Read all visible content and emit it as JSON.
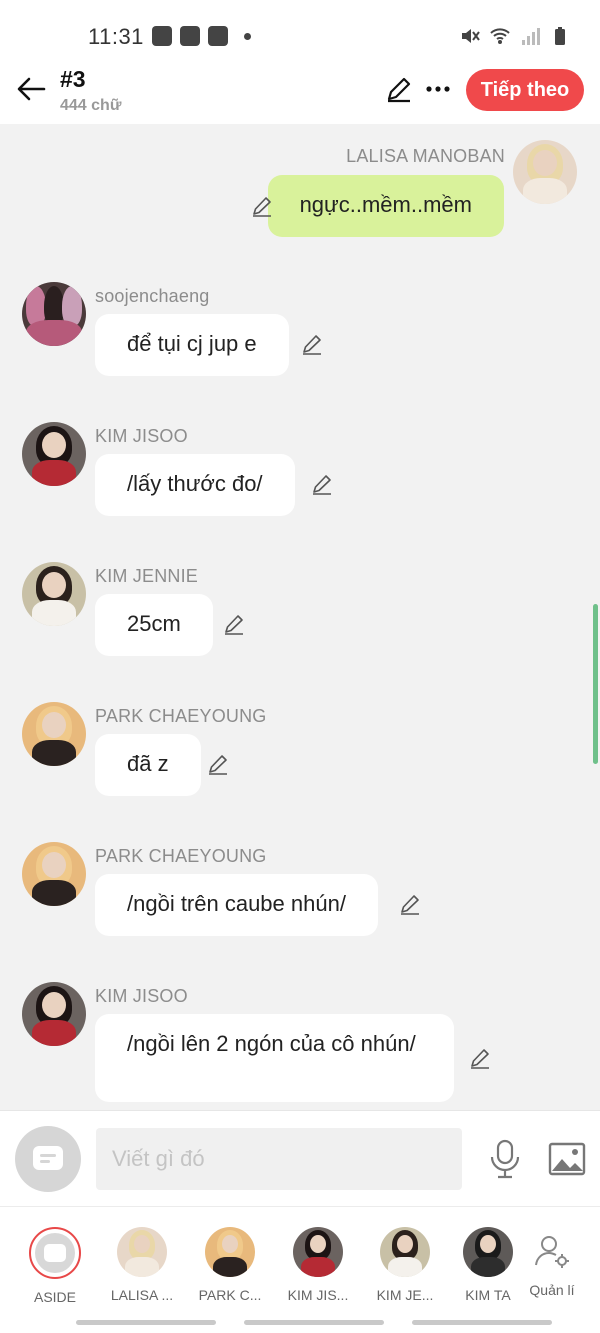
{
  "status_bar": {
    "time": "11:31"
  },
  "header": {
    "title": "#3",
    "subtitle": "444 chữ",
    "next_label": "Tiếp theo"
  },
  "messages": [
    {
      "sender": "LALISA MANOBAN",
      "text": "ngực..mềm..mềm",
      "side": "right",
      "avatar": "lisa"
    },
    {
      "sender": "soojenchaeng",
      "text": "để tụi cj jup e",
      "side": "left",
      "avatar": "group"
    },
    {
      "sender": "KIM JISOO",
      "text": "/lấy thước đo/",
      "side": "left",
      "avatar": "jisoo"
    },
    {
      "sender": "KIM JENNIE",
      "text": "25cm",
      "side": "left",
      "avatar": "jennie"
    },
    {
      "sender": "PARK CHAEYOUNG",
      "text": "đã z",
      "side": "left",
      "avatar": "rose"
    },
    {
      "sender": "PARK CHAEYOUNG",
      "text": "/ngồi trên caube nhún/",
      "side": "left",
      "avatar": "rose"
    },
    {
      "sender": "KIM JISOO",
      "text": "/ngồi lên 2 ngón của cô nhún/",
      "side": "left",
      "avatar": "jisoo"
    }
  ],
  "composer": {
    "placeholder": "Viết gì đó"
  },
  "characters": [
    {
      "label": "ASIDE"
    },
    {
      "label": "LALISA ..."
    },
    {
      "label": "PARK C..."
    },
    {
      "label": "KIM JIS..."
    },
    {
      "label": "KIM JE..."
    },
    {
      "label": "KIM TA"
    },
    {
      "label": "Quản lí"
    }
  ],
  "colors": {
    "accent": "#f0494b",
    "my_bubble": "#d9f29b",
    "background": "#f2f2f2"
  }
}
